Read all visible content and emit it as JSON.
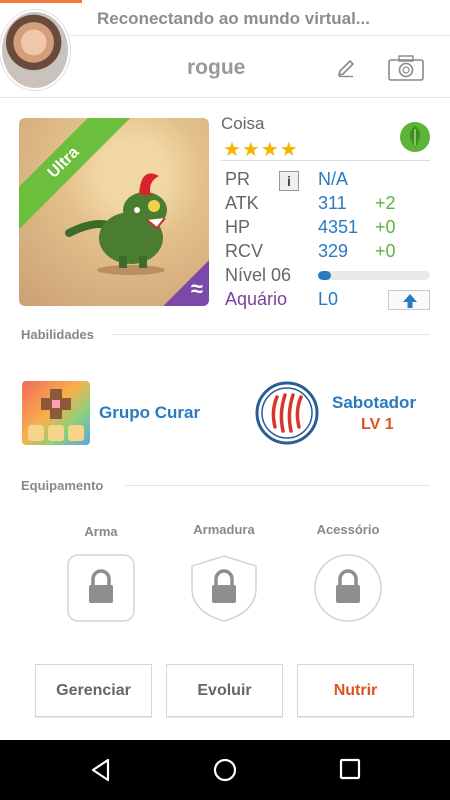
{
  "status": {
    "text": "Reconectando ao mundo virtual..."
  },
  "profile": {
    "username": "rogue"
  },
  "creature": {
    "badge": "Ultra",
    "element_symbol": "≈",
    "name": "Coisa",
    "stars": "★★★★",
    "stats": [
      {
        "label": "PR",
        "value": "N/A",
        "bonus": ""
      },
      {
        "label": "ATK",
        "value": "311",
        "bonus": "+2"
      },
      {
        "label": "HP",
        "value": "4351",
        "bonus": "+0"
      },
      {
        "label": "RCV",
        "value": "329",
        "bonus": "+0"
      }
    ],
    "level_label": "Nível 06",
    "level_progress": 0.12,
    "habitat_label": "Aquário",
    "habitat_level": "L0"
  },
  "skills": {
    "title": "Habilidades",
    "items": [
      {
        "name": "Grupo Curar",
        "level": ""
      },
      {
        "name": "Sabotador",
        "level": "LV 1"
      }
    ]
  },
  "equipment": {
    "title": "Equipamento",
    "slots": [
      {
        "label": "Arma"
      },
      {
        "label": "Armadura"
      },
      {
        "label": "Acessório"
      }
    ]
  },
  "actions": {
    "manage": "Gerenciar",
    "evolve": "Evoluir",
    "feed": "Nutrir"
  },
  "colors": {
    "accent_orange": "#e0531e",
    "stat_blue": "#2a7ac0",
    "bonus_green": "#5cb53a",
    "habitat_purple": "#7b3fa0",
    "star_yellow": "#f4b400"
  }
}
